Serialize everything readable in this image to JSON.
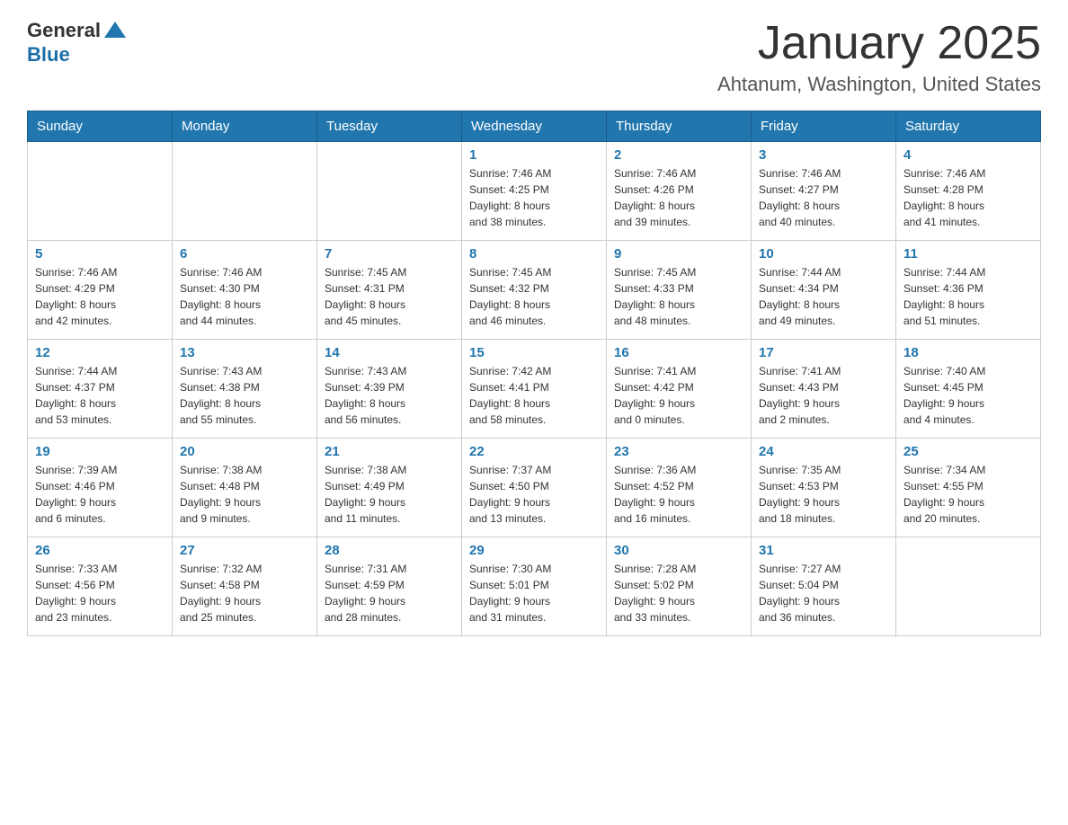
{
  "header": {
    "logo_general": "General",
    "logo_blue": "Blue",
    "month_title": "January 2025",
    "location": "Ahtanum, Washington, United States"
  },
  "days_of_week": [
    "Sunday",
    "Monday",
    "Tuesday",
    "Wednesday",
    "Thursday",
    "Friday",
    "Saturday"
  ],
  "weeks": [
    [
      {
        "day": "",
        "info": ""
      },
      {
        "day": "",
        "info": ""
      },
      {
        "day": "",
        "info": ""
      },
      {
        "day": "1",
        "info": "Sunrise: 7:46 AM\nSunset: 4:25 PM\nDaylight: 8 hours\nand 38 minutes."
      },
      {
        "day": "2",
        "info": "Sunrise: 7:46 AM\nSunset: 4:26 PM\nDaylight: 8 hours\nand 39 minutes."
      },
      {
        "day": "3",
        "info": "Sunrise: 7:46 AM\nSunset: 4:27 PM\nDaylight: 8 hours\nand 40 minutes."
      },
      {
        "day": "4",
        "info": "Sunrise: 7:46 AM\nSunset: 4:28 PM\nDaylight: 8 hours\nand 41 minutes."
      }
    ],
    [
      {
        "day": "5",
        "info": "Sunrise: 7:46 AM\nSunset: 4:29 PM\nDaylight: 8 hours\nand 42 minutes."
      },
      {
        "day": "6",
        "info": "Sunrise: 7:46 AM\nSunset: 4:30 PM\nDaylight: 8 hours\nand 44 minutes."
      },
      {
        "day": "7",
        "info": "Sunrise: 7:45 AM\nSunset: 4:31 PM\nDaylight: 8 hours\nand 45 minutes."
      },
      {
        "day": "8",
        "info": "Sunrise: 7:45 AM\nSunset: 4:32 PM\nDaylight: 8 hours\nand 46 minutes."
      },
      {
        "day": "9",
        "info": "Sunrise: 7:45 AM\nSunset: 4:33 PM\nDaylight: 8 hours\nand 48 minutes."
      },
      {
        "day": "10",
        "info": "Sunrise: 7:44 AM\nSunset: 4:34 PM\nDaylight: 8 hours\nand 49 minutes."
      },
      {
        "day": "11",
        "info": "Sunrise: 7:44 AM\nSunset: 4:36 PM\nDaylight: 8 hours\nand 51 minutes."
      }
    ],
    [
      {
        "day": "12",
        "info": "Sunrise: 7:44 AM\nSunset: 4:37 PM\nDaylight: 8 hours\nand 53 minutes."
      },
      {
        "day": "13",
        "info": "Sunrise: 7:43 AM\nSunset: 4:38 PM\nDaylight: 8 hours\nand 55 minutes."
      },
      {
        "day": "14",
        "info": "Sunrise: 7:43 AM\nSunset: 4:39 PM\nDaylight: 8 hours\nand 56 minutes."
      },
      {
        "day": "15",
        "info": "Sunrise: 7:42 AM\nSunset: 4:41 PM\nDaylight: 8 hours\nand 58 minutes."
      },
      {
        "day": "16",
        "info": "Sunrise: 7:41 AM\nSunset: 4:42 PM\nDaylight: 9 hours\nand 0 minutes."
      },
      {
        "day": "17",
        "info": "Sunrise: 7:41 AM\nSunset: 4:43 PM\nDaylight: 9 hours\nand 2 minutes."
      },
      {
        "day": "18",
        "info": "Sunrise: 7:40 AM\nSunset: 4:45 PM\nDaylight: 9 hours\nand 4 minutes."
      }
    ],
    [
      {
        "day": "19",
        "info": "Sunrise: 7:39 AM\nSunset: 4:46 PM\nDaylight: 9 hours\nand 6 minutes."
      },
      {
        "day": "20",
        "info": "Sunrise: 7:38 AM\nSunset: 4:48 PM\nDaylight: 9 hours\nand 9 minutes."
      },
      {
        "day": "21",
        "info": "Sunrise: 7:38 AM\nSunset: 4:49 PM\nDaylight: 9 hours\nand 11 minutes."
      },
      {
        "day": "22",
        "info": "Sunrise: 7:37 AM\nSunset: 4:50 PM\nDaylight: 9 hours\nand 13 minutes."
      },
      {
        "day": "23",
        "info": "Sunrise: 7:36 AM\nSunset: 4:52 PM\nDaylight: 9 hours\nand 16 minutes."
      },
      {
        "day": "24",
        "info": "Sunrise: 7:35 AM\nSunset: 4:53 PM\nDaylight: 9 hours\nand 18 minutes."
      },
      {
        "day": "25",
        "info": "Sunrise: 7:34 AM\nSunset: 4:55 PM\nDaylight: 9 hours\nand 20 minutes."
      }
    ],
    [
      {
        "day": "26",
        "info": "Sunrise: 7:33 AM\nSunset: 4:56 PM\nDaylight: 9 hours\nand 23 minutes."
      },
      {
        "day": "27",
        "info": "Sunrise: 7:32 AM\nSunset: 4:58 PM\nDaylight: 9 hours\nand 25 minutes."
      },
      {
        "day": "28",
        "info": "Sunrise: 7:31 AM\nSunset: 4:59 PM\nDaylight: 9 hours\nand 28 minutes."
      },
      {
        "day": "29",
        "info": "Sunrise: 7:30 AM\nSunset: 5:01 PM\nDaylight: 9 hours\nand 31 minutes."
      },
      {
        "day": "30",
        "info": "Sunrise: 7:28 AM\nSunset: 5:02 PM\nDaylight: 9 hours\nand 33 minutes."
      },
      {
        "day": "31",
        "info": "Sunrise: 7:27 AM\nSunset: 5:04 PM\nDaylight: 9 hours\nand 36 minutes."
      },
      {
        "day": "",
        "info": ""
      }
    ]
  ]
}
